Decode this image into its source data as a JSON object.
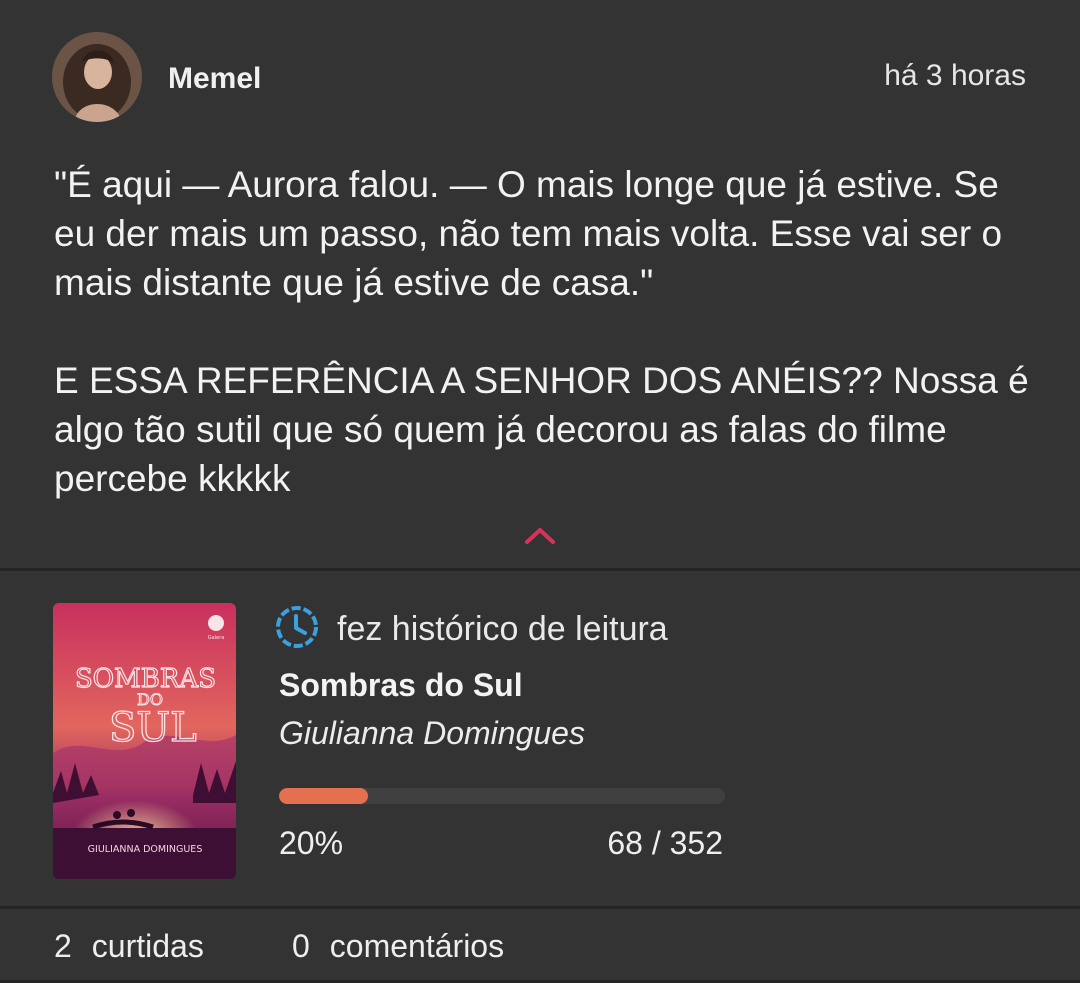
{
  "post": {
    "author": "Memel",
    "time": "há 3 horas",
    "paragraph_1": "\"É aqui — Aurora falou. — O mais longe que já estive. Se eu der mais um passo, não tem mais volta. Esse vai ser o mais distante que já estive de casa.\"",
    "paragraph_2": "E ESSA REFERÊNCIA A SENHOR DOS ANÉIS?? Nossa é algo tão sutil que só quem já decorou as falas do filme percebe kkkkk",
    "collapse_icon": "chevron-up-icon"
  },
  "activity": {
    "icon": "history-clock-icon",
    "label": "fez histórico de leitura",
    "book": {
      "title": "Sombras do Sul",
      "author": "Giulianna Domingues",
      "cover_title_line1": "SOMBRAS",
      "cover_title_line2": "DO",
      "cover_title_line3": "SUL",
      "cover_author": "GIULIANNA DOMINGUES"
    },
    "progress": {
      "fraction": 0.2,
      "percent_label": "20%",
      "pages_label": "68 / 352"
    }
  },
  "footer": {
    "likes_count": "2",
    "likes_label": "curtidas",
    "comments_count": "0",
    "comments_label": "comentários"
  },
  "colors": {
    "background": "#333333",
    "accent": "#d6325a",
    "progress": "#e4704f",
    "history_icon": "#3aa0e0"
  }
}
